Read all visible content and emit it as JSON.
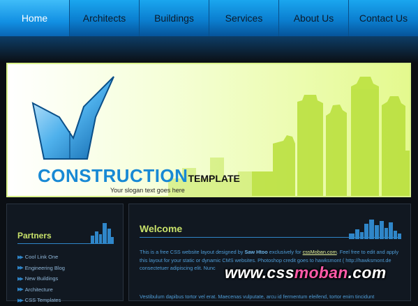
{
  "nav": {
    "items": [
      {
        "label": "Home",
        "active": true
      },
      {
        "label": "Architects",
        "active": false
      },
      {
        "label": "Buildings",
        "active": false
      },
      {
        "label": "Services",
        "active": false
      },
      {
        "label": "About Us",
        "active": false
      },
      {
        "label": "Contact Us",
        "active": false
      }
    ]
  },
  "header": {
    "brand_main": "CONSTRUCTION",
    "brand_sub": "TEMPLATE",
    "slogan": "Your slogan text goes here"
  },
  "sidebar": {
    "title": "Partners",
    "links": [
      "Cool Link One",
      "Engineering Blog",
      "New Buildings",
      "Architecture",
      "CSS Templates"
    ]
  },
  "main": {
    "title": "Welcome",
    "para_1": "This is a free CSS website layout designed by",
    "author": "Saw Htoo",
    "para_2": "exclusively for",
    "site_link": "cssMoban.com",
    "para_3": ". Feel free to edit and apply this layout for your static or dynamic CMS websites. Photoshop credit goes to hawksmont ( http://hawksmont.de",
    "para_4": "consectetuer adipiscing elit. Nunc",
    "para_5": "Vestibulum dapibus tortor vel erat. Maecenas vulputate, arcu id fermentum eleifend, tortor enim tincidunt"
  },
  "watermark": {
    "part_1": "www.css",
    "part_2": "moban",
    "part_3": ".com"
  },
  "colors": {
    "nav_blue": "#0b7fd0",
    "accent_green": "#c9e26a",
    "brand_blue": "#1889d4",
    "watermark_pink": "#ff5aa8"
  }
}
